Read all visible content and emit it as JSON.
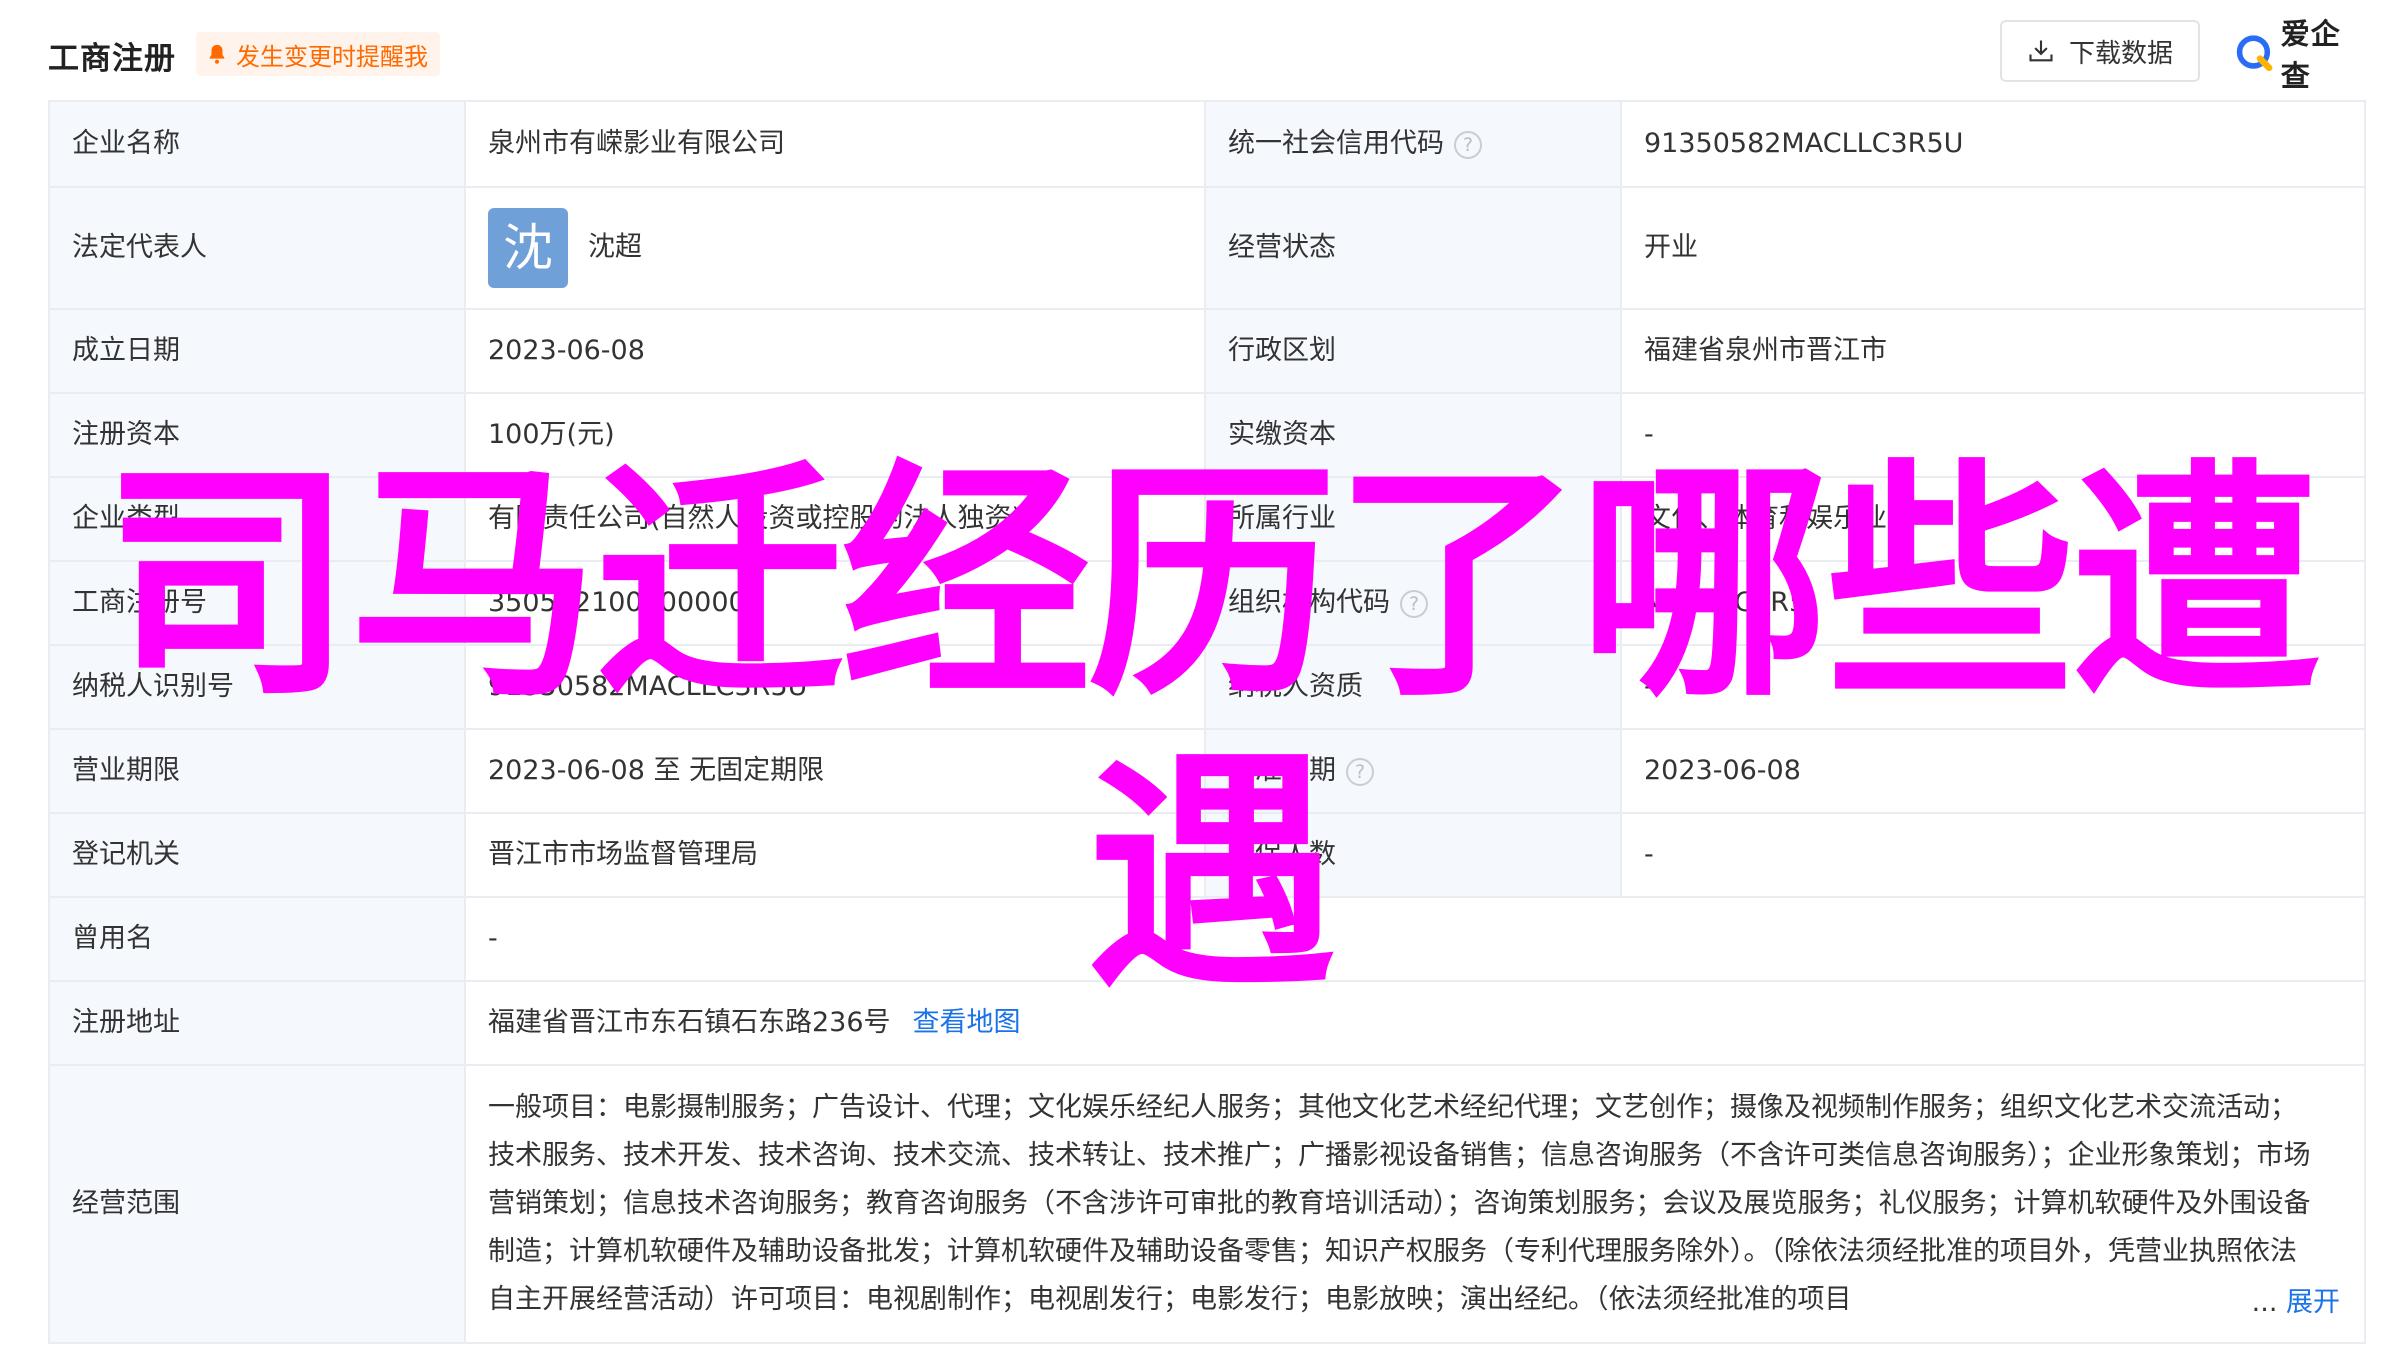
{
  "header": {
    "title": "工商注册",
    "notify_label": "发生变更时提醒我",
    "download_label": "下载数据",
    "logo_text": "爱企查"
  },
  "rows": [
    {
      "l1": "企业名称",
      "v1": "泉州市有嵘影业有限公司",
      "l2": "统一社会信用代码",
      "v2": "91350582MACLLC3R5U"
    },
    {
      "l1": "法定代表人",
      "avatar_char": "沈",
      "v1": "沈超",
      "l2": "经营状态",
      "v2": "开业"
    },
    {
      "l1": "成立日期",
      "v1": "2023-06-08",
      "l2": "行政区划",
      "v2": "福建省泉州市晋江市"
    },
    {
      "l1": "注册资本",
      "v1": "100万(元)",
      "l2": "实缴资本",
      "v2": "-"
    },
    {
      "l1": "企业类型",
      "v1": "有限责任公司(自然人投资或控股的法人独资)",
      "l2": "所属行业",
      "v2": "文化、体育和娱乐业"
    },
    {
      "l1": "工商注册号",
      "v1": "350582100000000",
      "l2": "组织机构代码",
      "v2": "MACLLC3R5"
    },
    {
      "l1": "纳税人识别号",
      "v1": "91350582MACLLC3R5U",
      "l2": "纳税人资质",
      "v2": "-"
    },
    {
      "l1": "营业期限",
      "v1": "2023-06-08 至 无固定期限",
      "l2": "核准日期",
      "v2": "2023-06-08"
    },
    {
      "l1": "登记机关",
      "v1": "晋江市市场监督管理局",
      "l2": "参保人数",
      "v2": "-"
    },
    {
      "l1": "曾用名",
      "v1": "-"
    },
    {
      "l1": "注册地址",
      "v1": "福建省晋江市东石镇石东路236号",
      "link": "查看地图"
    },
    {
      "l1": "经营范围",
      "v1": "一般项目：电影摄制服务；广告设计、代理；文化娱乐经纪人服务；其他文化艺术经纪代理；文艺创作；摄像及视频制作服务；组织文化艺术交流活动；技术服务、技术开发、技术咨询、技术交流、技术转让、技术推广；广播影视设备销售；信息咨询服务（不含许可类信息咨询服务）；企业形象策划；市场营销策划；信息技术咨询服务；教育咨询服务（不含涉许可审批的教育培训活动）；咨询策划服务；会议及展览服务；礼仪服务；计算机软硬件及外围设备制造；计算机软硬件及辅助设备批发；计算机软硬件及辅助设备零售；知识产权服务（专利代理服务除外）。（除依法须经批准的项目外，凭营业执照依法自主开展经营活动）许可项目：电视剧制作；电视剧发行；电影发行；电影放映；演出经纪。（依法须经批准的项目",
      "ellipsis": "...",
      "expand": "展开"
    }
  ],
  "overlay_text": "司马迁经历了哪些遭遇",
  "colors": {
    "overlay": "#ff00ff",
    "link": "#1a73e8",
    "notify": "#ff6a00",
    "label_bg": "#f5f8fd",
    "avatar_bg": "#6fa0d7"
  }
}
